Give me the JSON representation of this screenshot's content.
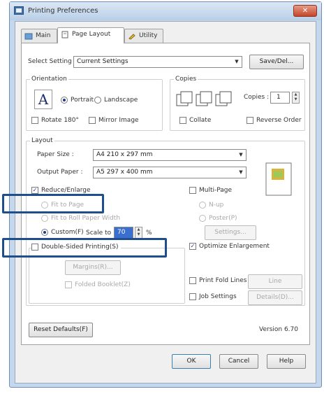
{
  "window": {
    "title": "Printing Preferences",
    "close_glyph": "✕"
  },
  "tabs": [
    {
      "label": "Main",
      "icon": "main-tab-icon"
    },
    {
      "label": "Page Layout",
      "icon": "page-layout-tab-icon"
    },
    {
      "label": "Utility",
      "icon": "utility-tab-icon"
    }
  ],
  "select_setting": {
    "label": "Select Setting :",
    "value": "Current Settings",
    "save_label": "Save/Del..."
  },
  "orientation": {
    "group_label": "Orientation",
    "portrait": "Portrait",
    "landscape": "Landscape",
    "letter": "A",
    "selected": "portrait",
    "rotate": "Rotate 180°",
    "mirror": "Mirror Image"
  },
  "copies": {
    "group_label": "Copies",
    "label": "Copies :",
    "value": "1",
    "collate": "Collate",
    "reverse": "Reverse Order"
  },
  "layout": {
    "group_label": "Layout",
    "paper_size_label": "Paper Size :",
    "paper_size_value": "A4 210 x 297 mm",
    "output_paper_label": "Output Paper :",
    "output_paper_value": "A5 297 x 400 mm",
    "reduce_enlarge": "Reduce/Enlarge",
    "reduce_enlarge_checked": true,
    "fit_to_page": "Fit to Page",
    "fit_to_roll": "Fit to Roll Paper Width",
    "custom": "Custom(F)",
    "scale_label": "Scale to",
    "scale_value": "70",
    "scale_unit": "%",
    "multi_page": "Multi-Page",
    "n_up": "N-up",
    "poster": "Poster(P)",
    "settings_btn": "Settings..."
  },
  "duplex": {
    "label": "Double-Sided Printing(S)",
    "margins_btn": "Margins(R)...",
    "folded": "Folded Booklet(Z)"
  },
  "optimize": {
    "label": "Optimize Enlargement",
    "checked": true
  },
  "extras": {
    "border_lines": "Print Fold Lines",
    "border_btn": "Line Settings(T)...",
    "job_settings": "Job Settings",
    "details_btn": "Details(D)..."
  },
  "footer": {
    "reset": "Reset Defaults(F)",
    "version": "Version 6.70",
    "ok": "OK",
    "cancel": "Cancel",
    "help": "Help"
  }
}
